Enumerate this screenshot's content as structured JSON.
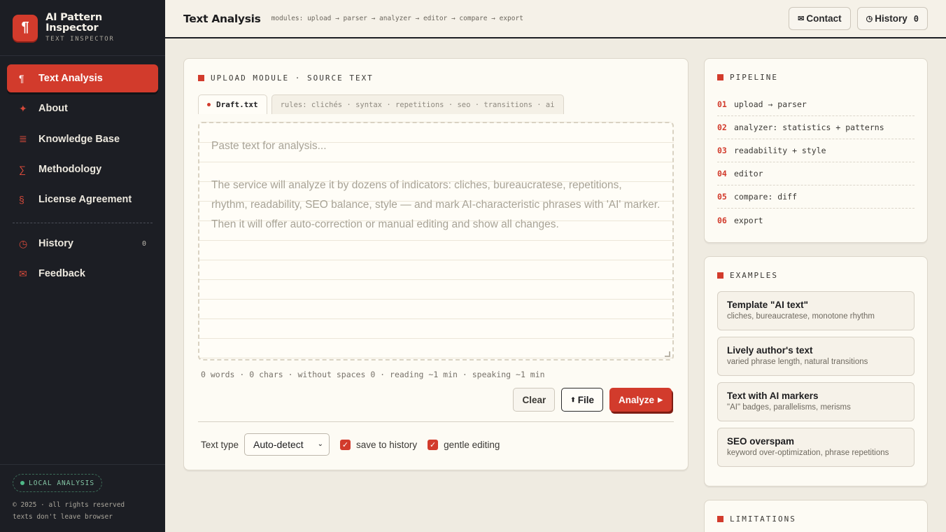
{
  "brand": {
    "logo_glyph": "¶",
    "name": "AI Pattern Inspector",
    "subtitle": "TEXT INSPECTOR"
  },
  "sidebar": {
    "items": [
      {
        "label": "Text Analysis",
        "icon": "pilcrow-icon",
        "glyph": "¶",
        "active": true
      },
      {
        "label": "About",
        "icon": "sparkle-icon",
        "glyph": "✦"
      },
      {
        "label": "Knowledge Base",
        "icon": "stack-lines-icon",
        "glyph": "≣"
      },
      {
        "label": "Methodology",
        "icon": "sigma-icon",
        "glyph": "∑"
      },
      {
        "label": "License Agreement",
        "icon": "section-icon",
        "glyph": "§"
      }
    ],
    "secondary": [
      {
        "label": "History",
        "icon": "clock-icon",
        "glyph": "◷",
        "count": "0"
      },
      {
        "label": "Feedback",
        "icon": "mail-icon",
        "glyph": "✉"
      }
    ],
    "footer": {
      "badge": "LOCAL ANALYSIS",
      "copyright": "© 2025 · all rights reserved",
      "note": "texts don't leave browser"
    }
  },
  "header": {
    "title": "Text Analysis",
    "modules": "modules: upload → parser → analyzer → editor → compare → export",
    "contact_label": "Contact",
    "contact_icon": "✉",
    "history_label": "History",
    "history_icon": "◷",
    "history_count": "0"
  },
  "main": {
    "section_title": "UPLOAD MODULE · SOURCE TEXT",
    "tab_active": "Draft.txt",
    "tab_rules": "rules: clichés · syntax · repetitions · seo · transitions · ai",
    "placeholder_line1": "Paste text for analysis...",
    "placeholder_line2": "The service will analyze it by dozens of indicators: cliches, bureaucratese, repetitions, rhythm, readability, SEO balance, style — and mark AI-characteristic phrases with 'AI' marker. Then it will offer auto-correction or manual editing and show all changes.",
    "stats": "0 words · 0 chars · without spaces 0 · reading ~1 min · speaking ~1 min",
    "clear_label": "Clear",
    "file_label": "File",
    "file_icon": "⬆",
    "analyze_label": "Analyze",
    "text_type_label": "Text type",
    "text_type_value": "Auto-detect",
    "save_history_label": "save to history",
    "save_history_checked": true,
    "gentle_editing_label": "gentle editing",
    "gentle_editing_checked": true
  },
  "pipeline": {
    "title": "PIPELINE",
    "steps": [
      {
        "num": "01",
        "text": "upload → parser"
      },
      {
        "num": "02",
        "text": "analyzer: statistics + patterns"
      },
      {
        "num": "03",
        "text": "readability + style"
      },
      {
        "num": "04",
        "text": "editor"
      },
      {
        "num": "05",
        "text": "compare: diff"
      },
      {
        "num": "06",
        "text": "export"
      }
    ]
  },
  "examples": {
    "title": "EXAMPLES",
    "items": [
      {
        "title": "Template \"AI text\"",
        "subtitle": "cliches, bureaucratese, monotone rhythm"
      },
      {
        "title": "Lively author's text",
        "subtitle": "varied phrase length, natural transitions"
      },
      {
        "title": "Text with AI markers",
        "subtitle": "\"AI\" badges, parallelisms, merisms"
      },
      {
        "title": "SEO overspam",
        "subtitle": "keyword over-optimization, phrase repetitions"
      }
    ]
  },
  "limitations": {
    "title": "LIMITATIONS"
  },
  "colors": {
    "accent": "#d23b2c",
    "sidebar_bg": "#1c1e24",
    "page_bg": "#efebe1",
    "panel_bg": "#fdfbf4"
  }
}
